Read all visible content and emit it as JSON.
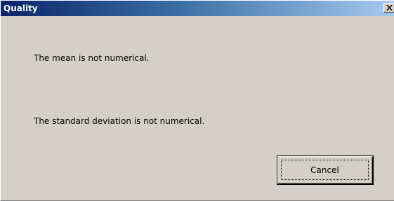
{
  "window": {
    "title": "Quality"
  },
  "title_bar": {
    "close_icon": "close-icon",
    "gradient_start": "#0a246a",
    "gradient_end": "#a6caf0"
  },
  "messages": {
    "mean": "The mean is not numerical.",
    "std": "The standard deviation is not numerical."
  },
  "buttons": {
    "cancel_label": "Cancel"
  },
  "colors": {
    "dialog_background": "#d4d0c8",
    "text": "#000000"
  }
}
